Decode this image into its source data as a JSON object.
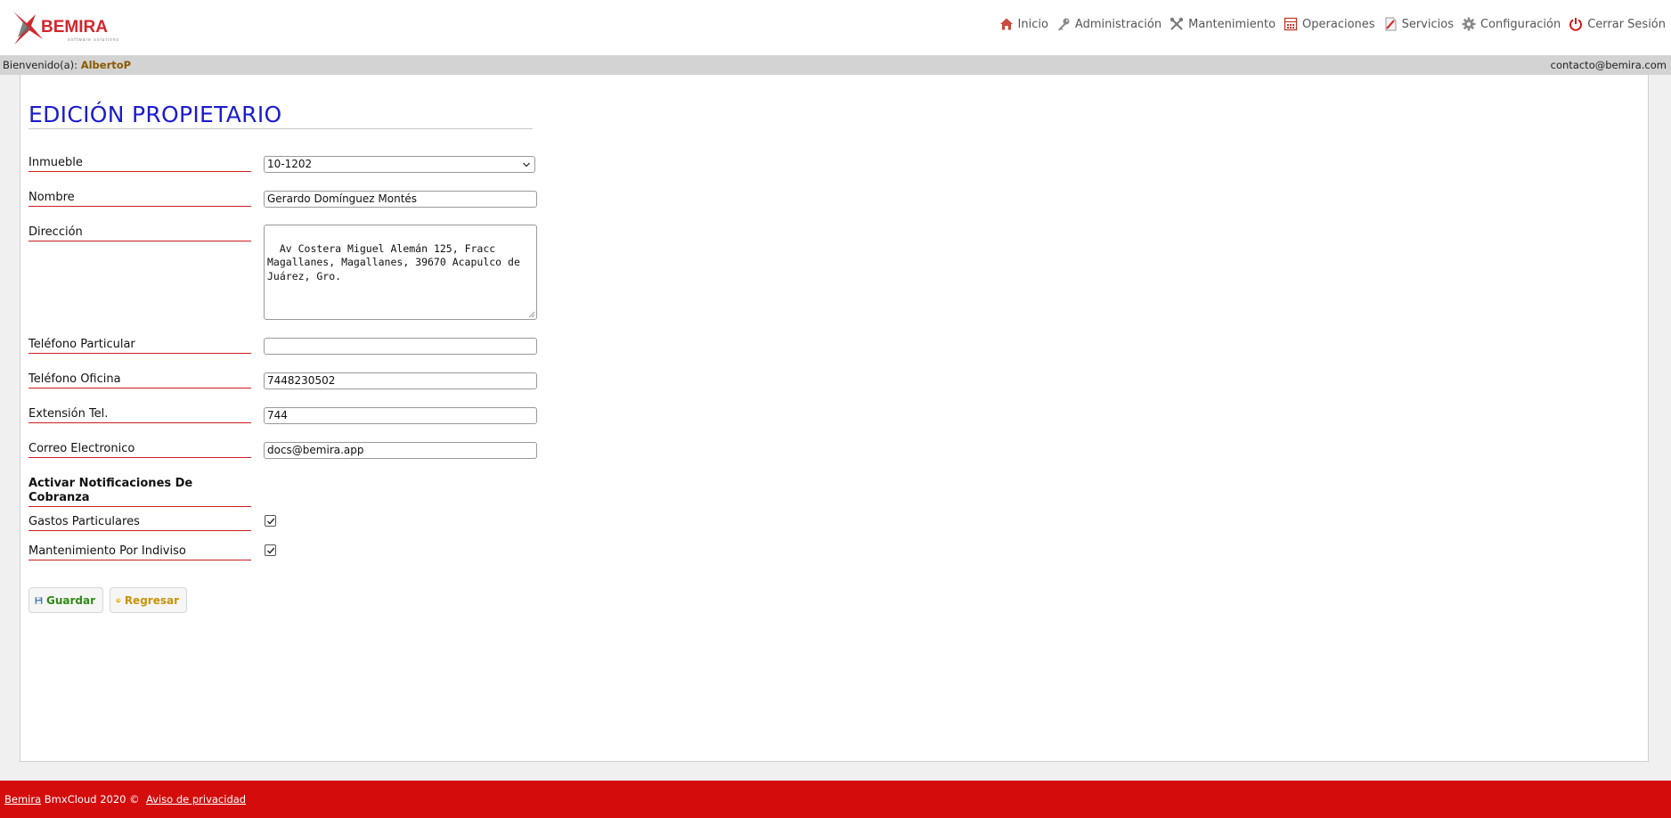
{
  "brand": {
    "name": "BEMIRA",
    "tagline": "software solutions",
    "accent_color": "#d4252c"
  },
  "nav": [
    {
      "label": "Inicio",
      "icon": "home-icon"
    },
    {
      "label": "Administración",
      "icon": "key-icon"
    },
    {
      "label": "Mantenimiento",
      "icon": "tools-icon"
    },
    {
      "label": "Operaciones",
      "icon": "calculator-icon"
    },
    {
      "label": "Servicios",
      "icon": "document-icon"
    },
    {
      "label": "Configuración",
      "icon": "gear-icon"
    },
    {
      "label": "Cerrar Sesión",
      "icon": "power-icon"
    }
  ],
  "welcome": {
    "prefix": "Bienvenido(a): ",
    "user": "AlbertoP",
    "contact": "contacto@bemira.com"
  },
  "page": {
    "title": "EDICIÓN PROPIETARIO"
  },
  "form": {
    "inmueble": {
      "label": "Inmueble",
      "value": "10-1202"
    },
    "nombre": {
      "label": "Nombre",
      "value": "Gerardo Domínguez Montés"
    },
    "direccion": {
      "label": "Dirección",
      "value": "Av Costera Miguel Alemán 125, Fracc Magallanes, Magallanes, 39670 Acapulco de Juárez, Gro."
    },
    "telefono_particular": {
      "label": "Teléfono Particular",
      "value": ""
    },
    "telefono_oficina": {
      "label": "Teléfono Oficina",
      "value": "7448230502"
    },
    "extension": {
      "label": "Extensión Tel.",
      "value": "744"
    },
    "correo": {
      "label": "Correo Electronico",
      "value": "docs@bemira.app"
    },
    "notificaciones_heading": "Activar Notificaciones De Cobranza",
    "gastos_particulares": {
      "label": "Gastos Particulares",
      "checked": true
    },
    "mantenimiento_indiviso": {
      "label": "Mantenimiento Por Indiviso",
      "checked": true
    }
  },
  "buttons": {
    "save": "Guardar",
    "back": "Regresar"
  },
  "footer": {
    "brand_link": "Bemira",
    "text": " BmxCloud 2020 © ",
    "privacy_link": "Aviso de privacidad",
    "background_color": "#d40c0c"
  }
}
